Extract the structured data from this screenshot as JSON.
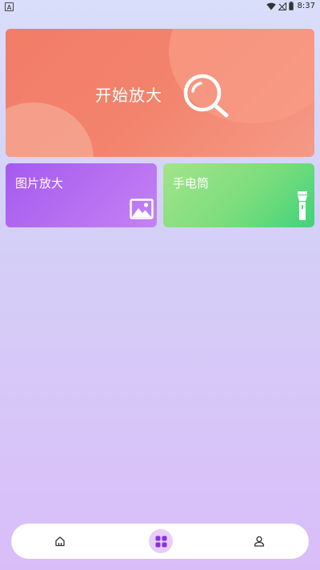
{
  "status_bar": {
    "time": "8:37",
    "left_indicator": "A",
    "icons": [
      "wifi-icon",
      "signal-icon",
      "battery-icon"
    ]
  },
  "hero_card": {
    "label": "开始放大",
    "icon": "magnifier-icon",
    "color": "#f27d68"
  },
  "tiles": [
    {
      "label": "图片放大",
      "icon": "image-icon",
      "color": "#a55aef"
    },
    {
      "label": "手电筒",
      "icon": "flashlight-icon",
      "color": "#4fd37b"
    }
  ],
  "bottom_nav": {
    "items": [
      {
        "icon": "home-icon",
        "active": false
      },
      {
        "icon": "apps-grid-icon",
        "active": true
      },
      {
        "icon": "user-icon",
        "active": false
      }
    ],
    "active_color": "#8b2fe0"
  }
}
